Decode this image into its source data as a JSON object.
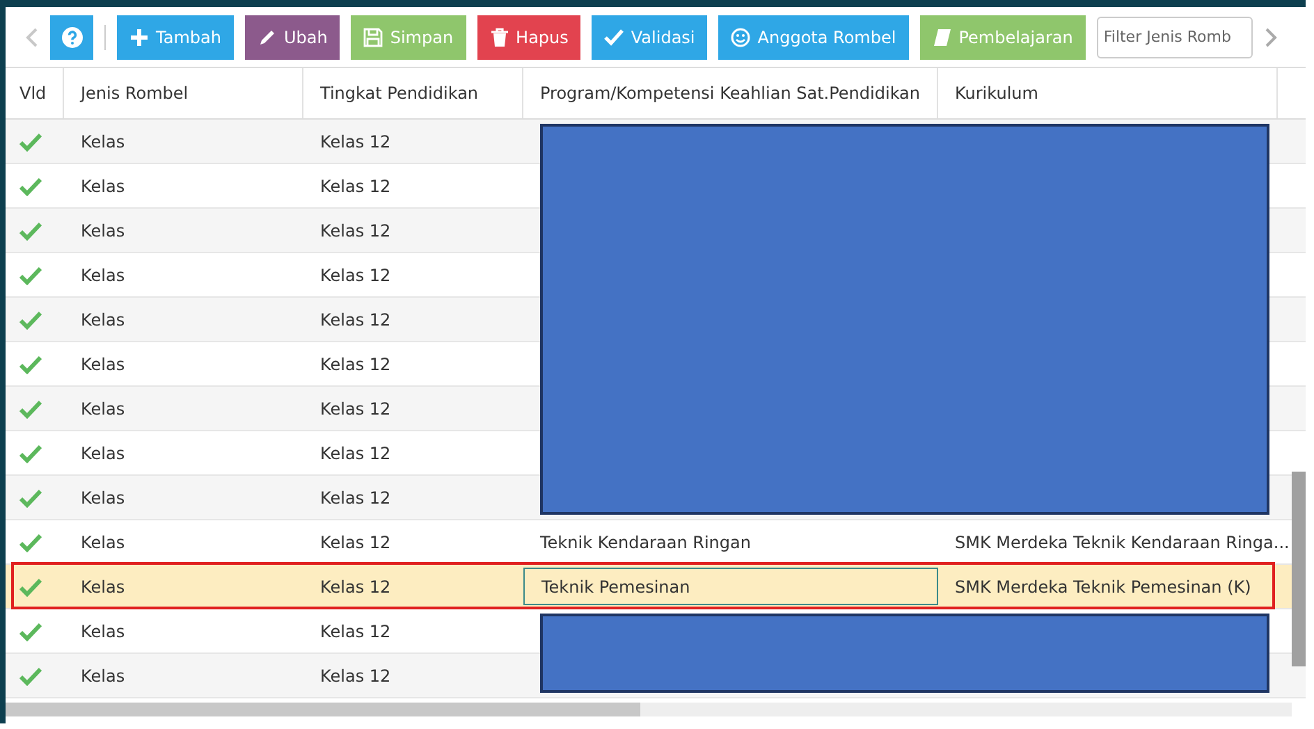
{
  "toolbar": {
    "buttons": [
      {
        "label": "Tambah",
        "color": "#2fa7e6"
      },
      {
        "label": "Ubah",
        "color": "#8c5a8c"
      },
      {
        "label": "Simpan",
        "color": "#8fc66c"
      },
      {
        "label": "Hapus",
        "color": "#e2434f"
      },
      {
        "label": "Validasi",
        "color": "#2fa7e6"
      },
      {
        "label": "Anggota Rombel",
        "color": "#2fa7e6"
      },
      {
        "label": "Pembelajaran",
        "color": "#8fc66c"
      }
    ],
    "filter": {
      "placeholder": "Filter Jenis Romb"
    }
  },
  "table": {
    "columns": [
      "Vld",
      "Jenis Rombel",
      "Tingkat Pendidikan",
      "Program/Kompetensi Keahlian Sat.Pendidikan",
      "Kurikulum"
    ],
    "rows": [
      {
        "valid": true,
        "jenis": "Kelas",
        "tingkat": "Kelas 12",
        "redacted": true,
        "selected": false
      },
      {
        "valid": true,
        "jenis": "Kelas",
        "tingkat": "Kelas 12",
        "redacted": true,
        "selected": false
      },
      {
        "valid": true,
        "jenis": "Kelas",
        "tingkat": "Kelas 12",
        "redacted": true,
        "selected": false
      },
      {
        "valid": true,
        "jenis": "Kelas",
        "tingkat": "Kelas 12",
        "redacted": true,
        "selected": false
      },
      {
        "valid": true,
        "jenis": "Kelas",
        "tingkat": "Kelas 12",
        "redacted": true,
        "selected": false
      },
      {
        "valid": true,
        "jenis": "Kelas",
        "tingkat": "Kelas 12",
        "redacted": true,
        "selected": false
      },
      {
        "valid": true,
        "jenis": "Kelas",
        "tingkat": "Kelas 12",
        "redacted": true,
        "selected": false
      },
      {
        "valid": true,
        "jenis": "Kelas",
        "tingkat": "Kelas 12",
        "redacted": true,
        "selected": false
      },
      {
        "valid": true,
        "jenis": "Kelas",
        "tingkat": "Kelas 12",
        "redacted": true,
        "selected": false
      },
      {
        "valid": true,
        "jenis": "Kelas",
        "tingkat": "Kelas 12",
        "program": "Teknik Kendaraan Ringan",
        "kurikulum": "SMK Merdeka Teknik Kendaraan Ringa...",
        "redacted": false,
        "selected": false
      },
      {
        "valid": true,
        "jenis": "Kelas",
        "tingkat": "Kelas 12",
        "program": "Teknik Pemesinan",
        "kurikulum": "SMK Merdeka Teknik Pemesinan (K)",
        "redacted": false,
        "selected": true
      },
      {
        "valid": true,
        "jenis": "Kelas",
        "tingkat": "Kelas 12",
        "redacted": true,
        "selected": false
      },
      {
        "valid": true,
        "jenis": "Kelas",
        "tingkat": "Kelas 12",
        "redacted": true,
        "selected": false
      }
    ]
  }
}
